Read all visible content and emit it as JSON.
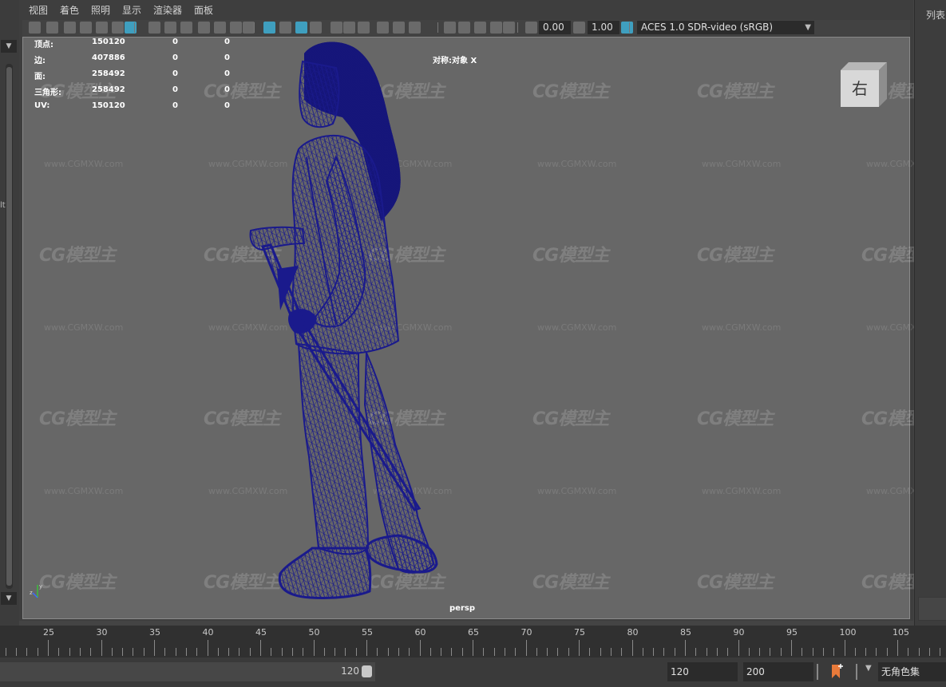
{
  "menu": {
    "items": [
      "视图",
      "着色",
      "照明",
      "显示",
      "渲染器",
      "面板"
    ]
  },
  "toolbar": {
    "exposure_value": "0.00",
    "gamma_value": "1.00",
    "color_space": "ACES 1.0 SDR-video (sRGB)",
    "icons": [
      "camera-icon",
      "camera-attributes-icon",
      "camera-select-icon",
      "bookmark-icon",
      "image-plane-icon",
      "2d-pan-zoom-icon",
      "grease-pencil-icon",
      "grid-icon",
      "film-gate-icon",
      "resolution-gate-icon",
      "gate-mask-icon",
      "field-chart-icon",
      "safe-action-icon",
      "safe-title-icon",
      "wireframe-icon",
      "smooth-shade-icon",
      "shade-wireframe-icon",
      "textured-icon",
      "use-all-lights-icon",
      "shadows-icon",
      "screen-space-ao-icon",
      "motion-blur-icon",
      "multisample-aa-icon",
      "depth-of-field-icon",
      "isolate-select-icon",
      "xray-icon",
      "xray-active-icon",
      "xray-joints-icon",
      "backface-icon",
      "exposure-icon",
      "gamma-icon",
      "color-management-icon"
    ]
  },
  "hud": {
    "stats": [
      {
        "label": "顶点:",
        "values": [
          "150120",
          "0",
          "0"
        ]
      },
      {
        "label": "边:",
        "values": [
          "407886",
          "0",
          "0"
        ]
      },
      {
        "label": "面:",
        "values": [
          "258492",
          "0",
          "0"
        ]
      },
      {
        "label": "三角形:",
        "values": [
          "258492",
          "0",
          "0"
        ]
      },
      {
        "label": "UV:",
        "values": [
          "150120",
          "0",
          "0"
        ]
      }
    ],
    "object_label": "对称:对象 X",
    "camera_name": "persp",
    "view_cube_label": "右",
    "axis_labels": {
      "y": "y",
      "z": "z"
    }
  },
  "right_panel": {
    "label": "列表"
  },
  "left_panel": {
    "label": "lt"
  },
  "watermark": {
    "logo": "CG模型主",
    "url": "www.CGMXW.com"
  },
  "timeline": {
    "labels": [
      "25",
      "30",
      "35",
      "40",
      "45",
      "50",
      "55",
      "60",
      "65",
      "70",
      "75",
      "80",
      "85",
      "90",
      "95",
      "100",
      "105"
    ]
  },
  "range": {
    "current_end": "120",
    "end_time": "120",
    "playback_end": "200",
    "character_set": "无角色集"
  },
  "colors": {
    "wireframe": "#1a1a8c",
    "viewport_bg": "#676767",
    "toolbar_active": "#3f9fbf"
  }
}
